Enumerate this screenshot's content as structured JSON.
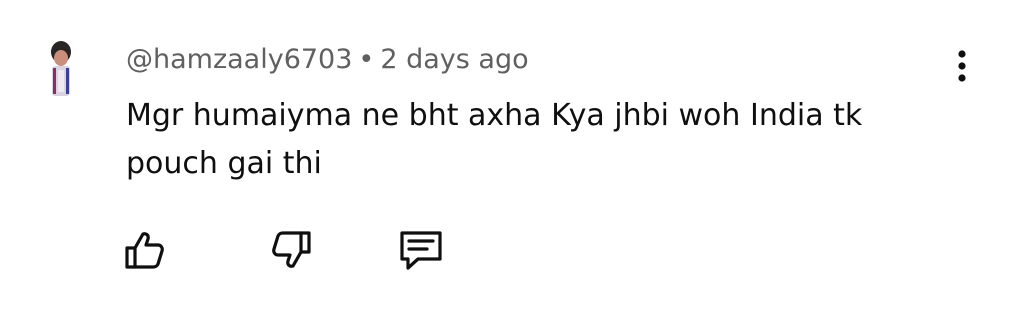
{
  "comment": {
    "author": "@hamzaaly6703",
    "separator": "•",
    "timestamp": "2 days ago",
    "text_line1": "Mgr humaiyma ne bht axha Kya jhbi woh India tk",
    "text_line2": "pouch gai thi"
  },
  "icons": {
    "avatar": "user-avatar",
    "more": "more-vert-icon",
    "like": "thumb-up-icon",
    "dislike": "thumb-down-icon",
    "reply": "reply-comment-icon"
  },
  "colors": {
    "meta_text": "#606060",
    "body_text": "#0f0f0f",
    "icon": "#0f0f0f",
    "background": "#ffffff"
  }
}
